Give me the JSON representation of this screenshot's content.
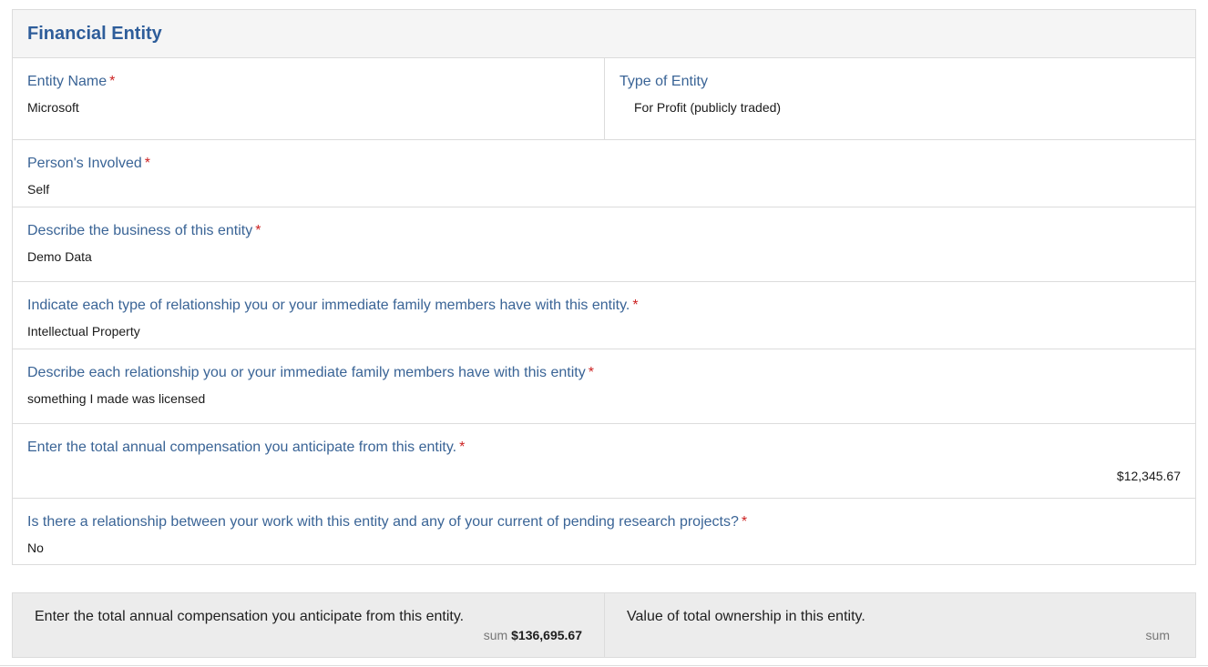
{
  "panel": {
    "title": "Financial Entity"
  },
  "fields": {
    "entity_name": {
      "label": "Entity Name",
      "required": "*",
      "value": "Microsoft"
    },
    "entity_type": {
      "label": "Type of Entity",
      "value": "For Profit (publicly traded)"
    },
    "persons_involved": {
      "label": "Person's Involved",
      "required": "*",
      "value": "Self"
    },
    "business_description": {
      "label": "Describe the business of this entity",
      "required": "*",
      "value": "Demo Data"
    },
    "relationship_type": {
      "label": "Indicate each type of relationship you or your immediate family members have with this entity.",
      "required": "*",
      "value": "Intellectual Property"
    },
    "relationship_description": {
      "label": "Describe each relationship you or your immediate family members have with this entity",
      "required": "*",
      "value": "something I made was licensed"
    },
    "annual_compensation": {
      "label": "Enter the total annual compensation you anticipate from this entity.",
      "required": "*",
      "value": "$12,345.67"
    },
    "research_relationship": {
      "label": "Is there a relationship between your work with this entity and any of your current of pending research projects?",
      "required": "*",
      "value": "No"
    }
  },
  "summary": {
    "compensation": {
      "label": "Enter the total annual compensation you anticipate from this entity.",
      "sum_label": "sum",
      "sum_value": "$136,695.67"
    },
    "ownership": {
      "label": "Value of total ownership in this entity.",
      "sum_label": "sum",
      "sum_value": ""
    }
  },
  "colors": {
    "title": "#2e5d9a",
    "label": "#3a6496",
    "required": "#cc2222",
    "header_bg": "#f5f5f5",
    "summary_bg": "#ececec",
    "border": "#dcdcdc"
  }
}
